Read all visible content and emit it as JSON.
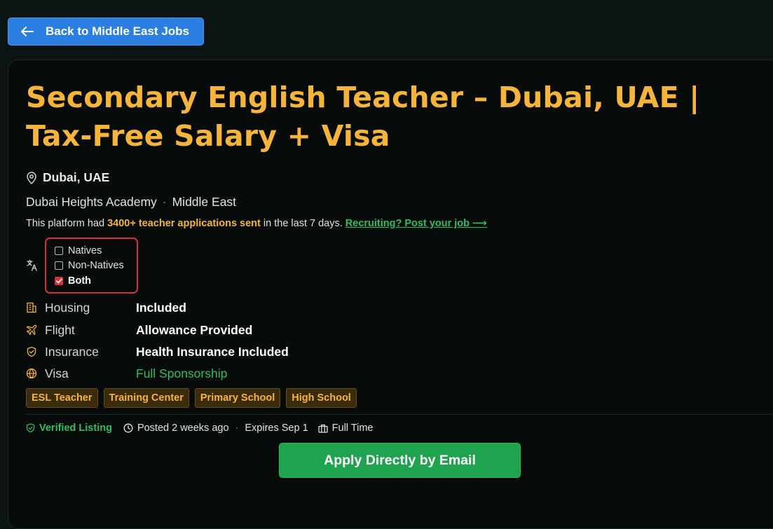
{
  "back_button": {
    "label": "Back to Middle East Jobs",
    "icon": "arrow-left-icon"
  },
  "job": {
    "title": "Secondary English Teacher – Dubai, UAE | Tax-Free Salary + Visa",
    "location": "Dubai, UAE",
    "company": "Dubai Heights Academy",
    "region": "Middle East"
  },
  "stats": {
    "prefix": "This platform had",
    "highlight": "3400+ teacher applications sent",
    "suffix": "in the last 7 days.",
    "link": "Recruiting? Post your job ⟶"
  },
  "language_options": [
    {
      "label": "Natives",
      "checked": false
    },
    {
      "label": "Non-Natives",
      "checked": false
    },
    {
      "label": "Both",
      "checked": true
    }
  ],
  "benefits": [
    {
      "icon": "building-icon",
      "label": "Housing",
      "value": "Included"
    },
    {
      "icon": "plane-icon",
      "label": "Flight",
      "value": "Allowance Provided"
    },
    {
      "icon": "shield-icon",
      "label": "Insurance",
      "value": "Health Insurance Included"
    },
    {
      "icon": "globe-icon",
      "label": "Visa",
      "value": "Full Sponsorship"
    }
  ],
  "tags": [
    "ESL Teacher",
    "Training Center",
    "Primary School",
    "High School"
  ],
  "meta": {
    "verified": "Verified Listing",
    "posted": "Posted 2 weeks ago",
    "expires": "Expires Sep 1",
    "type": "Full Time"
  },
  "apply_button": "Apply Directly by Email",
  "colors": {
    "background": "#0b1412",
    "accent_orange": "#f6b53a",
    "primary_blue": "#2b7fe0",
    "success_green": "#1fa34f",
    "highlight_red": "#d8303a"
  }
}
